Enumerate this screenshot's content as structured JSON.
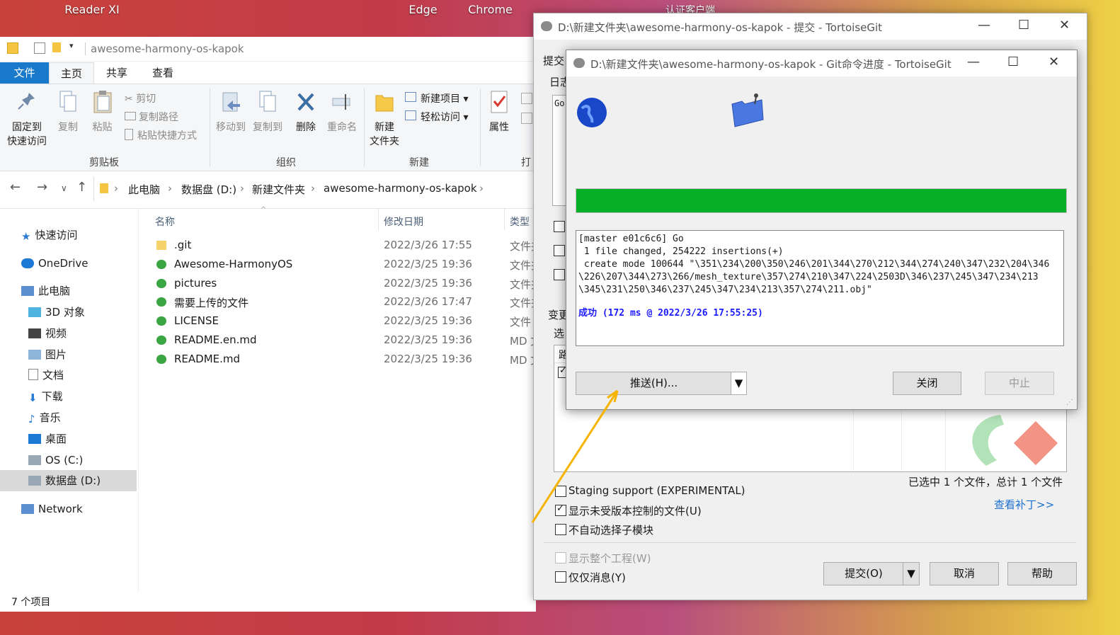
{
  "desktop": {
    "icons": [
      "Reader XI",
      "Edge",
      "Chrome",
      "认证客户端"
    ]
  },
  "explorer": {
    "title": "awesome-harmony-os-kapok",
    "tabs": [
      "文件",
      "主页",
      "共享",
      "查看"
    ],
    "ribbon": {
      "pin": "固定到\n快速访问",
      "pin_l1": "固定到",
      "pin_l2": "快速访问",
      "copy": "复制",
      "paste": "粘贴",
      "cut": "剪切",
      "copy_path": "复制路径",
      "paste_shortcut": "粘贴快捷方式",
      "group_clipboard": "剪贴板",
      "move_to": "移动到",
      "copy_to": "复制到",
      "delete": "删除",
      "rename": "重命名",
      "group_organize": "组织",
      "new_folder_l1": "新建",
      "new_folder_l2": "文件夹",
      "new_item": "新建项目",
      "easy_access": "轻松访问",
      "group_new": "新建",
      "properties": "属性",
      "group_open": "打开"
    },
    "breadcrumb": [
      "此电脑",
      "数据盘 (D:)",
      "新建文件夹",
      "awesome-harmony-os-kapok"
    ],
    "nav": {
      "quick_access": "快速访问",
      "onedrive": "OneDrive",
      "this_pc": "此电脑",
      "objects3d": "3D 对象",
      "videos": "视频",
      "pictures": "图片",
      "documents": "文档",
      "downloads": "下载",
      "music": "音乐",
      "desktop": "桌面",
      "os_c": "OS (C:)",
      "data_d": "数据盘 (D:)",
      "network": "Network"
    },
    "columns": {
      "name": "名称",
      "date": "修改日期",
      "type": "类型"
    },
    "files": [
      {
        "name": ".git",
        "date": "2022/3/26 17:55",
        "type": "文件夹"
      },
      {
        "name": "Awesome-HarmonyOS",
        "date": "2022/3/25 19:36",
        "type": "文件夹"
      },
      {
        "name": "pictures",
        "date": "2022/3/25 19:36",
        "type": "文件夹"
      },
      {
        "name": "需要上传的文件",
        "date": "2022/3/26 17:47",
        "type": "文件夹"
      },
      {
        "name": "LICENSE",
        "date": "2022/3/25 19:36",
        "type": "文件"
      },
      {
        "name": "README.en.md",
        "date": "2022/3/25 19:36",
        "type": "MD 文件"
      },
      {
        "name": "README.md",
        "date": "2022/3/25 19:36",
        "type": "MD 文件"
      }
    ],
    "status": "7 个项目"
  },
  "commit_dialog": {
    "title": "D:\\新建文件夹\\awesome-harmony-os-kapok - 提交 - TortoiseGit",
    "section_commit": "提交",
    "section_log": "日志",
    "message_snippet": "Go",
    "section_changes": "变更",
    "select_label": "选",
    "path_header": "路",
    "staging": "Staging support (EXPERIMENTAL)",
    "show_unversioned": "显示未受版本控制的文件(U)",
    "no_autoselect_sub": "不自动选择子模块",
    "selection_summary": "已选中 1 个文件，总计 1 个文件",
    "view_patch": "查看补丁>>",
    "show_whole_project": "显示整个工程(W)",
    "message_only": "仅仅消息(Y)",
    "commit_btn": "提交(O)",
    "cancel_btn": "取消",
    "help_btn": "帮助"
  },
  "progress_dialog": {
    "title": "D:\\新建文件夹\\awesome-harmony-os-kapok - Git命令进度 - TortoiseGit",
    "progress": 1.0,
    "log_lines": [
      "[master e01c6c6] Go",
      " 1 file changed, 254222 insertions(+)",
      " create mode 100644 \"\\351\\234\\200\\350\\246\\201\\344\\270\\212\\344\\274\\240\\347\\232\\204\\346",
      "\\226\\207\\344\\273\\266/mesh_texture\\357\\274\\210\\347\\224\\2503D\\346\\237\\245\\347\\234\\213",
      "\\345\\231\\250\\346\\237\\245\\347\\234\\213\\357\\274\\211.obj\""
    ],
    "success": "成功 (172 ms @ 2022/3/26 17:55:25)",
    "push_btn": "推送(H)...",
    "close_btn": "关闭",
    "abort_btn": "中止"
  },
  "colors": {
    "accent_blue": "#1979ca",
    "progress_green": "#06b026",
    "success_blue": "#1a1aff",
    "arrow_orange": "#f5b400"
  }
}
